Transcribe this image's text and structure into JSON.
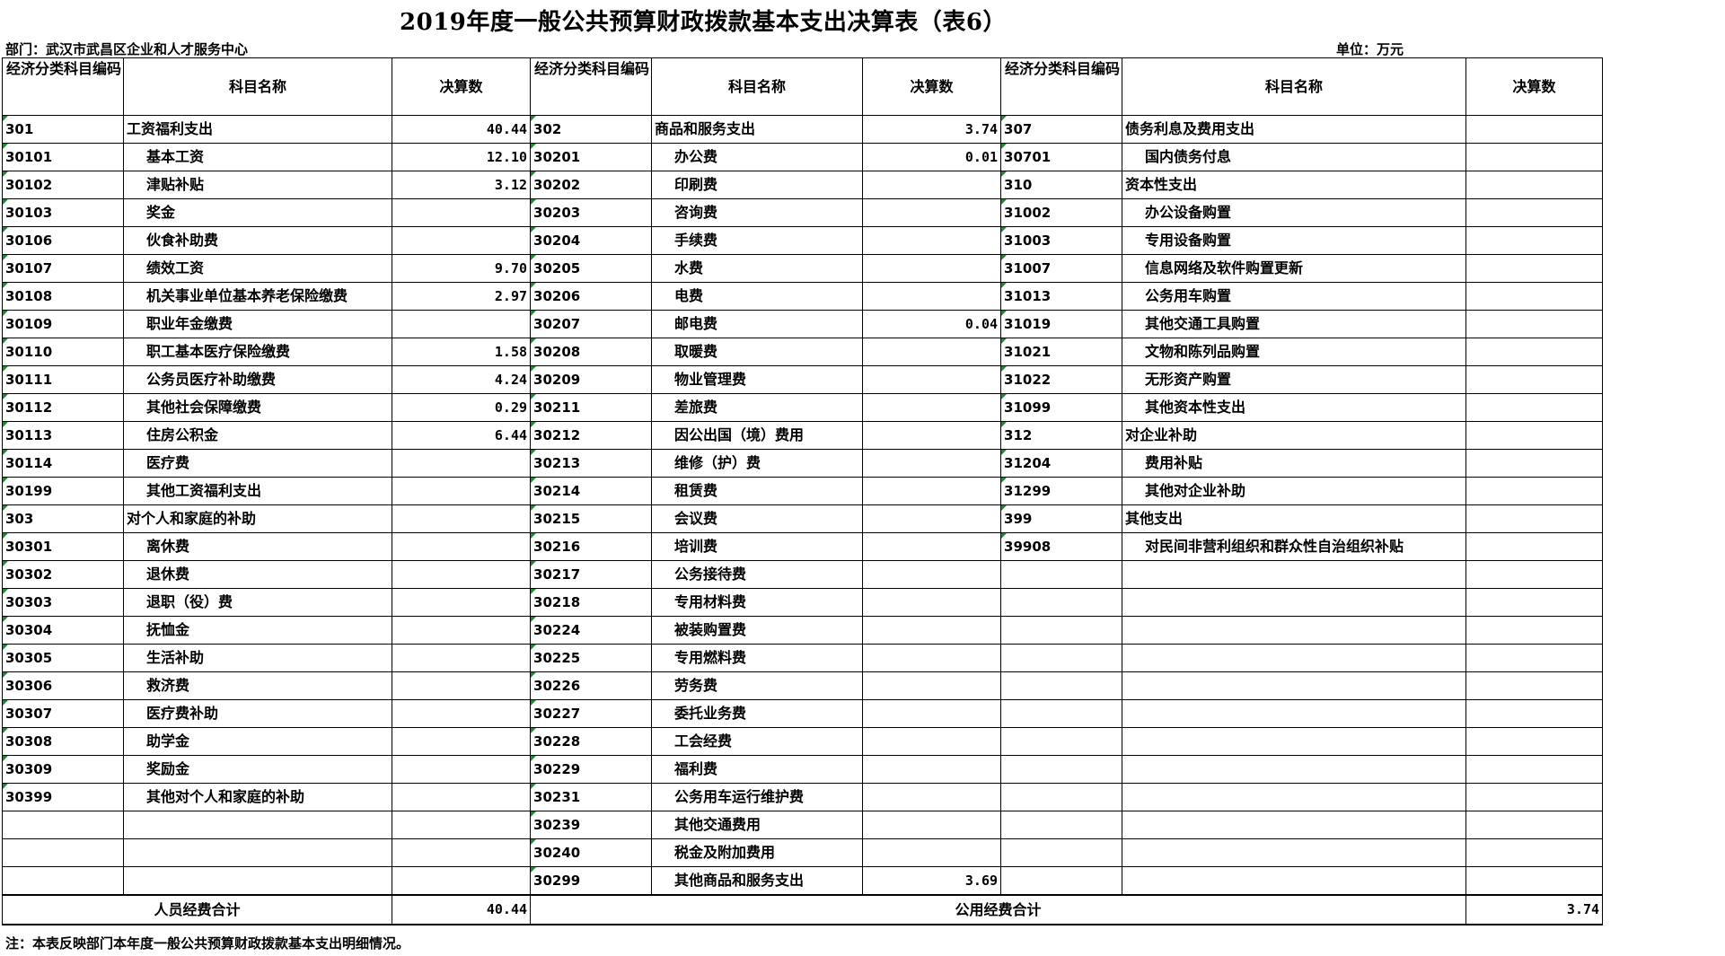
{
  "title": "2019年度一般公共预算财政拨款基本支出决算表（表6）",
  "department": "部门：武汉市武昌区企业和人才服务中心",
  "unit": "单位：万元",
  "headers": {
    "code": "经济分类科目编码",
    "name": "科目名称",
    "amount": "决算数"
  },
  "rows": [
    [
      {
        "code": "301",
        "name": "工资福利支出",
        "amt": "40.44",
        "lvl": 1
      },
      {
        "code": "302",
        "name": "商品和服务支出",
        "amt": "3.74",
        "lvl": 1
      },
      {
        "code": "307",
        "name": "债务利息及费用支出",
        "amt": "",
        "lvl": 1
      }
    ],
    [
      {
        "code": "30101",
        "name": "基本工资",
        "amt": "12.10",
        "lvl": 2
      },
      {
        "code": "30201",
        "name": "办公费",
        "amt": "0.01",
        "lvl": 2
      },
      {
        "code": "30701",
        "name": "国内债务付息",
        "amt": "",
        "lvl": 2
      }
    ],
    [
      {
        "code": "30102",
        "name": "津贴补贴",
        "amt": "3.12",
        "lvl": 2
      },
      {
        "code": "30202",
        "name": "印刷费",
        "amt": "",
        "lvl": 2
      },
      {
        "code": "310",
        "name": "资本性支出",
        "amt": "",
        "lvl": 1
      }
    ],
    [
      {
        "code": "30103",
        "name": "奖金",
        "amt": "",
        "lvl": 2
      },
      {
        "code": "30203",
        "name": "咨询费",
        "amt": "",
        "lvl": 2
      },
      {
        "code": "31002",
        "name": "办公设备购置",
        "amt": "",
        "lvl": 2
      }
    ],
    [
      {
        "code": "30106",
        "name": "伙食补助费",
        "amt": "",
        "lvl": 2
      },
      {
        "code": "30204",
        "name": "手续费",
        "amt": "",
        "lvl": 2
      },
      {
        "code": "31003",
        "name": "专用设备购置",
        "amt": "",
        "lvl": 2
      }
    ],
    [
      {
        "code": "30107",
        "name": "绩效工资",
        "amt": "9.70",
        "lvl": 2
      },
      {
        "code": "30205",
        "name": "水费",
        "amt": "",
        "lvl": 2
      },
      {
        "code": "31007",
        "name": "信息网络及软件购置更新",
        "amt": "",
        "lvl": 2
      }
    ],
    [
      {
        "code": "30108",
        "name": "机关事业单位基本养老保险缴费",
        "amt": "2.97",
        "lvl": 2
      },
      {
        "code": "30206",
        "name": "电费",
        "amt": "",
        "lvl": 2
      },
      {
        "code": "31013",
        "name": "公务用车购置",
        "amt": "",
        "lvl": 2
      }
    ],
    [
      {
        "code": "30109",
        "name": "职业年金缴费",
        "amt": "",
        "lvl": 2
      },
      {
        "code": "30207",
        "name": "邮电费",
        "amt": "0.04",
        "lvl": 2
      },
      {
        "code": "31019",
        "name": "其他交通工具购置",
        "amt": "",
        "lvl": 2
      }
    ],
    [
      {
        "code": "30110",
        "name": "职工基本医疗保险缴费",
        "amt": "1.58",
        "lvl": 2
      },
      {
        "code": "30208",
        "name": "取暖费",
        "amt": "",
        "lvl": 2
      },
      {
        "code": "31021",
        "name": "文物和陈列品购置",
        "amt": "",
        "lvl": 2
      }
    ],
    [
      {
        "code": "30111",
        "name": "公务员医疗补助缴费",
        "amt": "4.24",
        "lvl": 2
      },
      {
        "code": "30209",
        "name": "物业管理费",
        "amt": "",
        "lvl": 2
      },
      {
        "code": "31022",
        "name": "无形资产购置",
        "amt": "",
        "lvl": 2
      }
    ],
    [
      {
        "code": "30112",
        "name": "其他社会保障缴费",
        "amt": "0.29",
        "lvl": 2
      },
      {
        "code": "30211",
        "name": "差旅费",
        "amt": "",
        "lvl": 2
      },
      {
        "code": "31099",
        "name": "其他资本性支出",
        "amt": "",
        "lvl": 2
      }
    ],
    [
      {
        "code": "30113",
        "name": "住房公积金",
        "amt": "6.44",
        "lvl": 2
      },
      {
        "code": "30212",
        "name": "因公出国（境）费用",
        "amt": "",
        "lvl": 2
      },
      {
        "code": "312",
        "name": "对企业补助",
        "amt": "",
        "lvl": 1
      }
    ],
    [
      {
        "code": "30114",
        "name": "医疗费",
        "amt": "",
        "lvl": 2
      },
      {
        "code": "30213",
        "name": "维修（护）费",
        "amt": "",
        "lvl": 2
      },
      {
        "code": "31204",
        "name": "费用补贴",
        "amt": "",
        "lvl": 2
      }
    ],
    [
      {
        "code": "30199",
        "name": "其他工资福利支出",
        "amt": "",
        "lvl": 2
      },
      {
        "code": "30214",
        "name": "租赁费",
        "amt": "",
        "lvl": 2
      },
      {
        "code": "31299",
        "name": "其他对企业补助",
        "amt": "",
        "lvl": 2
      }
    ],
    [
      {
        "code": "303",
        "name": "对个人和家庭的补助",
        "amt": "",
        "lvl": 1
      },
      {
        "code": "30215",
        "name": "会议费",
        "amt": "",
        "lvl": 2
      },
      {
        "code": "399",
        "name": "其他支出",
        "amt": "",
        "lvl": 1
      }
    ],
    [
      {
        "code": "30301",
        "name": "离休费",
        "amt": "",
        "lvl": 2
      },
      {
        "code": "30216",
        "name": "培训费",
        "amt": "",
        "lvl": 2
      },
      {
        "code": "39908",
        "name": "对民间非营利组织和群众性自治组织补贴",
        "amt": "",
        "lvl": 2
      }
    ],
    [
      {
        "code": "30302",
        "name": "退休费",
        "amt": "",
        "lvl": 2
      },
      {
        "code": "30217",
        "name": "公务接待费",
        "amt": "",
        "lvl": 2
      },
      {
        "code": "",
        "name": "",
        "amt": "",
        "lvl": 1
      }
    ],
    [
      {
        "code": "30303",
        "name": "退职（役）费",
        "amt": "",
        "lvl": 2
      },
      {
        "code": "30218",
        "name": "专用材料费",
        "amt": "",
        "lvl": 2
      },
      {
        "code": "",
        "name": "",
        "amt": "",
        "lvl": 1
      }
    ],
    [
      {
        "code": "30304",
        "name": "抚恤金",
        "amt": "",
        "lvl": 2
      },
      {
        "code": "30224",
        "name": "被装购置费",
        "amt": "",
        "lvl": 2
      },
      {
        "code": "",
        "name": "",
        "amt": "",
        "lvl": 1
      }
    ],
    [
      {
        "code": "30305",
        "name": "生活补助",
        "amt": "",
        "lvl": 2
      },
      {
        "code": "30225",
        "name": "专用燃料费",
        "amt": "",
        "lvl": 2
      },
      {
        "code": "",
        "name": "",
        "amt": "",
        "lvl": 1
      }
    ],
    [
      {
        "code": "30306",
        "name": "救济费",
        "amt": "",
        "lvl": 2
      },
      {
        "code": "30226",
        "name": "劳务费",
        "amt": "",
        "lvl": 2
      },
      {
        "code": "",
        "name": "",
        "amt": "",
        "lvl": 1
      }
    ],
    [
      {
        "code": "30307",
        "name": "医疗费补助",
        "amt": "",
        "lvl": 2
      },
      {
        "code": "30227",
        "name": "委托业务费",
        "amt": "",
        "lvl": 2
      },
      {
        "code": "",
        "name": "",
        "amt": "",
        "lvl": 1
      }
    ],
    [
      {
        "code": "30308",
        "name": "助学金",
        "amt": "",
        "lvl": 2
      },
      {
        "code": "30228",
        "name": "工会经费",
        "amt": "",
        "lvl": 2
      },
      {
        "code": "",
        "name": "",
        "amt": "",
        "lvl": 1
      }
    ],
    [
      {
        "code": "30309",
        "name": "奖励金",
        "amt": "",
        "lvl": 2
      },
      {
        "code": "30229",
        "name": "福利费",
        "amt": "",
        "lvl": 2
      },
      {
        "code": "",
        "name": "",
        "amt": "",
        "lvl": 1
      }
    ],
    [
      {
        "code": "30399",
        "name": "其他对个人和家庭的补助",
        "amt": "",
        "lvl": 2
      },
      {
        "code": "30231",
        "name": "公务用车运行维护费",
        "amt": "",
        "lvl": 2
      },
      {
        "code": "",
        "name": "",
        "amt": "",
        "lvl": 1
      }
    ],
    [
      {
        "code": "",
        "name": "",
        "amt": "",
        "lvl": 1
      },
      {
        "code": "30239",
        "name": "其他交通费用",
        "amt": "",
        "lvl": 2
      },
      {
        "code": "",
        "name": "",
        "amt": "",
        "lvl": 1
      }
    ],
    [
      {
        "code": "",
        "name": "",
        "amt": "",
        "lvl": 1
      },
      {
        "code": "30240",
        "name": "税金及附加费用",
        "amt": "",
        "lvl": 2
      },
      {
        "code": "",
        "name": "",
        "amt": "",
        "lvl": 1
      }
    ],
    [
      {
        "code": "",
        "name": "",
        "amt": "",
        "lvl": 1
      },
      {
        "code": "30299",
        "name": "其他商品和服务支出",
        "amt": "3.69",
        "lvl": 2
      },
      {
        "code": "",
        "name": "",
        "amt": "",
        "lvl": 1
      }
    ]
  ],
  "totals": {
    "personnel_label": "人员经费合计",
    "personnel_value": "40.44",
    "public_label": "公用经费合计",
    "public_value": "3.74"
  },
  "note": "注：本表反映部门本年度一般公共预算财政拨款基本支出明细情况。",
  "colors": {
    "marker": "#1a8c2e",
    "grid": "#000000"
  }
}
